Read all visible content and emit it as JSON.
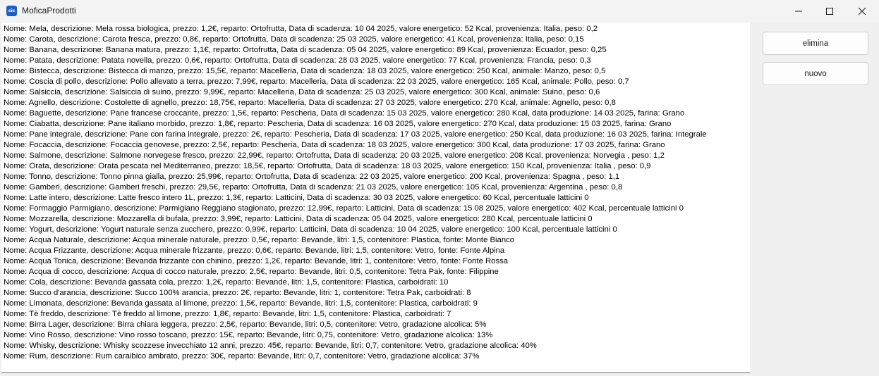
{
  "window": {
    "title": "MoficaProdotti",
    "app_icon_text": "sis",
    "controls": {
      "minimize_icon": "minimize-icon",
      "maximize_icon": "maximize-icon",
      "close_icon": "close-icon"
    }
  },
  "buttons": {
    "elimina": "elimina",
    "nuovo": "nuovo"
  },
  "products": [
    "Nome: Mela, descrizione: Mela rossa biologica, prezzo: 1,2€, reparto: Ortofrutta, Data di scadenza: 10 04 2025, valore energetico: 52 Kcal, provenienza: Italia, peso: 0,2",
    "Nome: Carota, descrizione: Carota fresca, prezzo: 0,8€, reparto: Ortofrutta, Data di scadenza: 25 03 2025, valore energetico: 41 Kcal, provenienza: Italia, peso: 0,15",
    "Nome: Banana, descrizione: Banana matura, prezzo: 1,1€, reparto: Ortofrutta, Data di scadenza: 05 04 2025, valore energetico: 89 Kcal, provenienza: Ecuador, peso: 0,25",
    "Nome: Patata, descrizione: Patata novella, prezzo: 0,6€, reparto: Ortofrutta, Data di scadenza: 28 03 2025, valore energetico: 77 Kcal, provenienza: Francia, peso: 0,3",
    "Nome: Bistecca, descrizione: Bistecca di manzo, prezzo: 15,5€, reparto: Macelleria, Data di scadenza: 18 03 2025, valore energetico: 250 Kcal, animale: Manzo, peso: 0,5",
    "Nome: Coscia di pollo, descrizione: Pollo allevato a terra, prezzo: 7,99€, reparto: Macelleria, Data di scadenza: 22 03 2025, valore energetico: 165 Kcal, animale: Pollo, peso: 0,7",
    "Nome: Salsiccia, descrizione: Salsiccia di suino, prezzo: 9,99€, reparto: Macelleria, Data di scadenza: 25 03 2025, valore energetico: 300 Kcal, animale: Suino, peso: 0,6",
    "Nome: Agnello, descrizione: Costolette di agnello, prezzo: 18,75€, reparto: Macelleria, Data di scadenza: 27 03 2025, valore energetico: 270 Kcal, animale: Agnello, peso: 0,8",
    "Nome: Baguette, descrizione: Pane francese croccante, prezzo: 1,5€, reparto: Pescheria, Data di scadenza: 15 03 2025, valore energetico: 280 Kcal, data produzione: 14 03 2025, farina: Grano",
    "Nome: Ciabatta, descrizione: Pane italiano morbido, prezzo: 1,8€, reparto: Pescheria, Data di scadenza: 16 03 2025, valore energetico: 270 Kcal, data produzione: 15 03 2025, farina: Grano",
    "Nome: Pane integrale, descrizione: Pane con farina integrale, prezzo: 2€, reparto: Pescheria, Data di scadenza: 17 03 2025, valore energetico: 250 Kcal, data produzione: 16 03 2025, farina: Integrale",
    "Nome: Focaccia, descrizione: Focaccia genovese, prezzo: 2,5€, reparto: Pescheria, Data di scadenza: 18 03 2025, valore energetico: 300 Kcal, data produzione: 17 03 2025, farina: Grano",
    "Nome: Salmone, descrizione: Salmone norvegese fresco, prezzo: 22,99€, reparto: Ortofrutta, Data di scadenza: 20 03 2025, valore energetico: 208 Kcal, provenienza: Norvegia , peso: 1,2",
    "Nome: Orata, descrizione: Orata pescata nel Mediterraneo, prezzo: 18,5€, reparto: Ortofrutta, Data di scadenza: 18 03 2025, valore energetico: 150 Kcal, provenienza: Italia , peso: 0,9",
    "Nome: Tonno, descrizione: Tonno pinna gialla, prezzo: 25,99€, reparto: Ortofrutta, Data di scadenza: 22 03 2025, valore energetico: 200 Kcal, provenienza: Spagna , peso: 1,1",
    "Nome: Gamberi, descrizione: Gamberi freschi, prezzo: 29,5€, reparto: Ortofrutta, Data di scadenza: 21 03 2025, valore energetico: 105 Kcal, provenienza: Argentina , peso: 0,8",
    "Nome: Latte intero, descrizione: Latte fresco intero 1L, prezzo: 1,3€, reparto: Latticini, Data di scadenza: 30 03 2025, valore energetico: 60 Kcal, percentuale latticini 0",
    "Nome: Formaggio Parmigiano, descrizione: Parmigiano Reggiano stagionato, prezzo: 12,99€, reparto: Latticini, Data di scadenza: 15 08 2025, valore energetico: 402 Kcal, percentuale latticini 0",
    "Nome: Mozzarella, descrizione: Mozzarella di bufala, prezzo: 3,99€, reparto: Latticini, Data di scadenza: 05 04 2025, valore energetico: 280 Kcal, percentuale latticini 0",
    "Nome: Yogurt, descrizione: Yogurt naturale senza zucchero, prezzo: 0,99€, reparto: Latticini, Data di scadenza: 10 04 2025, valore energetico: 100 Kcal, percentuale latticini 0",
    "Nome: Acqua Naturale, descrizione: Acqua minerale naturale, prezzo: 0,5€, reparto: Bevande, litri: 1,5, contenitore: Plastica, fonte: Monte Bianco",
    "Nome: Acqua Frizzante, descrizione: Acqua minerale frizzante, prezzo: 0,6€, reparto: Bevande, litri: 1,5, contenitore: Vetro, fonte: Fonte Alpina",
    "Nome: Acqua Tonica, descrizione: Bevanda frizzante con chinino, prezzo: 1,2€, reparto: Bevande, litri: 1, contenitore: Vetro, fonte: Fonte Rossa",
    "Nome: Acqua di cocco, descrizione: Acqua di cocco naturale, prezzo: 2,5€, reparto: Bevande, litri: 0,5, contenitore: Tetra Pak, fonte: Filippine",
    "Nome: Cola, descrizione: Bevanda gassata cola, prezzo: 1,2€, reparto: Bevande, litri: 1,5, contenitore: Plastica, carboidrati: 10",
    "Nome: Succo d'arancia, descrizione: Succo 100% arancia, prezzo: 2€, reparto: Bevande, litri: 1, contenitore: Tetra Pak, carboidrati: 8",
    "Nome: Limonata, descrizione: Bevanda gassata al limone, prezzo: 1,5€, reparto: Bevande, litri: 1,5, contenitore: Plastica, carboidrati: 9",
    "Nome: Tè freddo, descrizione: Tè freddo al limone, prezzo: 1,8€, reparto: Bevande, litri: 1,5, contenitore: Plastica, carboidrati: 7",
    "Nome: Birra Lager, descrizione: Birra chiara leggera, prezzo: 2,5€, reparto: Bevande, litri: 0,5, contenitore: Vetro, gradazione alcolica: 5%",
    "Nome: Vino Rosso, descrizione: Vino rosso toscano, prezzo: 15€, reparto: Bevande, litri: 0,75, contenitore: Vetro, gradazione alcolica: 13%",
    "Nome: Whisky, descrizione: Whisky scozzese invecchiato 12 anni, prezzo: 45€, reparto: Bevande, litri: 0,7, contenitore: Vetro, gradazione alcolica: 40%",
    "Nome: Rum, descrizione: Rum caraibico ambrato, prezzo: 30€, reparto: Bevande, litri: 0,7, contenitore: Vetro, gradazione alcolica: 37%"
  ]
}
